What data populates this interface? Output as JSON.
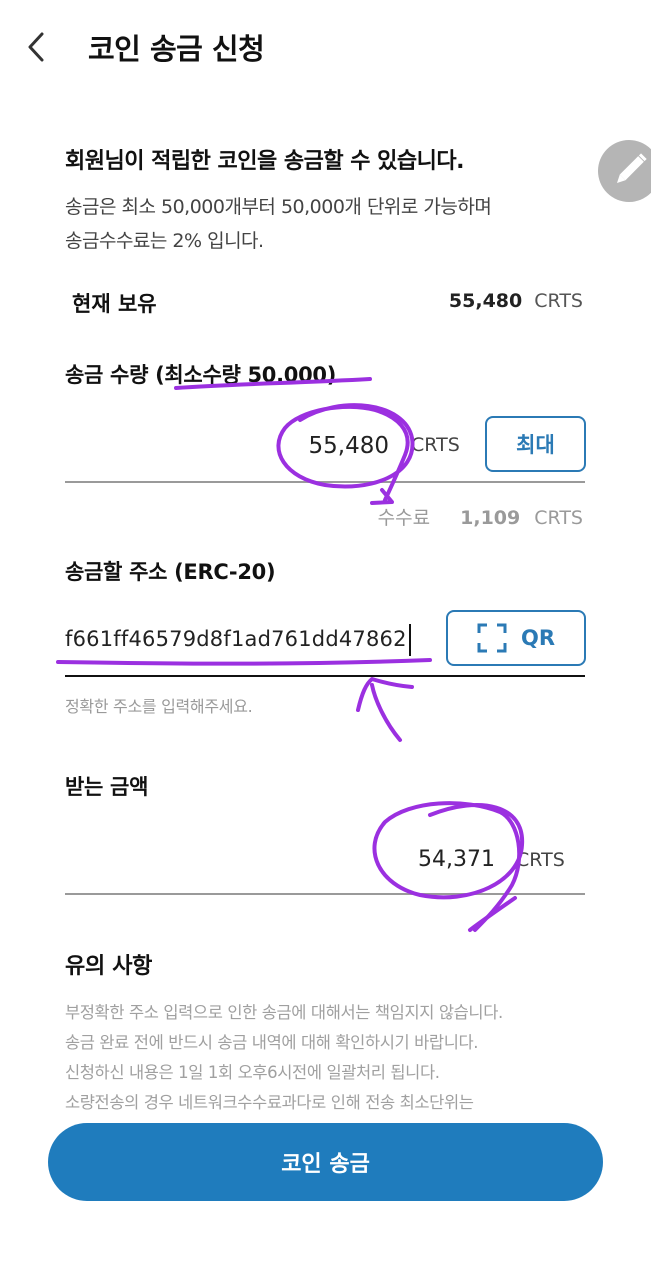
{
  "header": {
    "title": "코인 송금 신청",
    "back_icon": "chevron-left-icon"
  },
  "intro": {
    "heading": "회원님이 적립한 코인을 송금할 수 있습니다.",
    "desc_line1": "송금은 최소 50,000개부터 50,000개 단위로 가능하며",
    "desc_line2": "송금수수료는 2% 입니다."
  },
  "holding": {
    "label": "현재 보유",
    "value": "55,480",
    "unit": "CRTS"
  },
  "amount": {
    "label": "송금 수량 (최소수량 50,000)",
    "value": "55,480",
    "unit": "CRTS",
    "max_button": "최대",
    "fee_label": "수수료",
    "fee_value": "1,109",
    "fee_unit": "CRTS"
  },
  "address": {
    "label": "송금할 주소 (ERC-20)",
    "value": "f661ff46579d8f1ad761dd47862",
    "qr_button": "QR",
    "hint": "정확한 주소를 입력해주세요."
  },
  "receive": {
    "label": "받는 금액",
    "value": "54,371",
    "unit": "CRTS"
  },
  "notice": {
    "title": "유의 사항",
    "lines": [
      "부정확한 주소 입력으로 인한 송금에 대해서는 책임지지 않습니다.",
      "송금 완료 전에 반드시 송금 내역에 대해 확인하시기 바랍니다.",
      "신청하신 내용은 1일 1회 오후6시전에 일괄처리 됩니다.",
      "소량전송의 경우 네트워크수수료과다로 인해 전송 최소단위는"
    ]
  },
  "submit": {
    "label": "코인 송금"
  },
  "colors": {
    "accent": "#1f7cbd",
    "annotation": "#9b30e0",
    "fab": "#b5b5b5"
  }
}
